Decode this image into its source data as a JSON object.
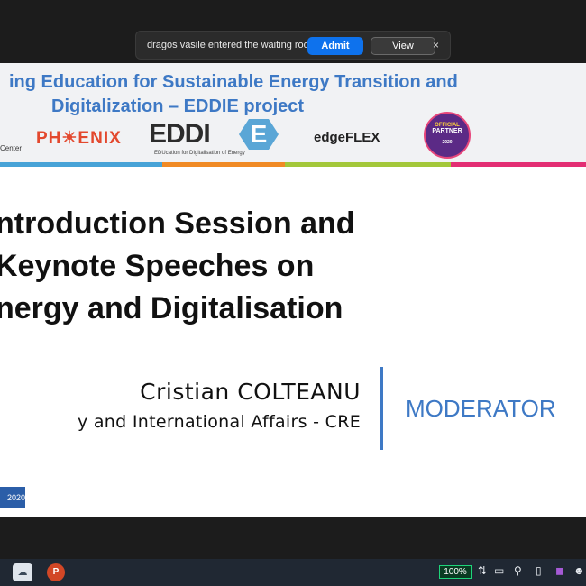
{
  "notification": {
    "message": "dragos vasile entered the waiting room",
    "admit_label": "Admit",
    "view_label": "View",
    "close_glyph": "×"
  },
  "slide": {
    "header": {
      "title_line1": "ing Education for Sustainable Energy Transition and",
      "title_line2": "Digitalization – EDDIE project"
    },
    "logos": {
      "center_text": "Center",
      "phoenix": "PH☀ENIX",
      "eddie": "EDDI",
      "eddie_hex": "E",
      "eddie_sub": "EDUcation for DIgitalisation of Energy",
      "edgeflex": "edgeFLEX",
      "partner_l1": "OFFICIAL",
      "partner_l2": "PARTNER",
      "partner_year": "2020"
    },
    "session_title": [
      "ntroduction Session and",
      "Keynote Speeches on",
      "nergy and Digitalisation"
    ],
    "speaker_name": "Cristian COLTEANU",
    "speaker_role": "y and International Affairs - CRE",
    "role_tag": "MODERATOR",
    "badge_text": "2020"
  },
  "taskbar": {
    "app1_icon": "cloud-icon",
    "app2_label": "P",
    "battery": "100%",
    "tray_icons": [
      "sync-icon",
      "note-icon",
      "pin-icon",
      "phone-icon",
      "onenote-icon",
      "people-icon"
    ]
  },
  "colors": {
    "accent_blue": "#3e79c5",
    "admit_blue": "#0e72ed",
    "battery_green": "#1fd47a"
  }
}
